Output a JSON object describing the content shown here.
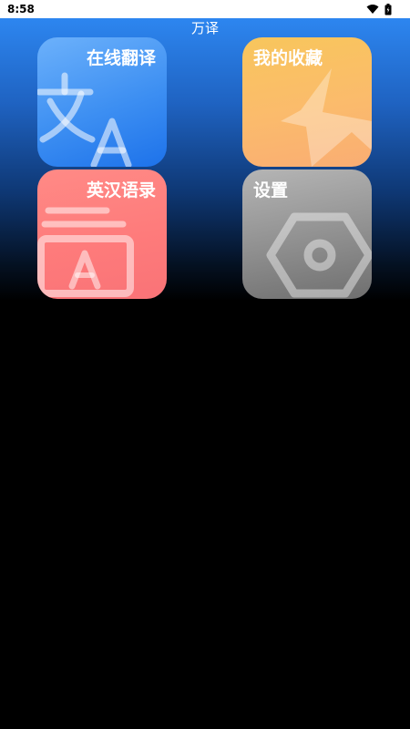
{
  "status_bar": {
    "time": "8:58",
    "icons": [
      "wifi-icon",
      "battery-icon"
    ]
  },
  "app": {
    "title": "万译"
  },
  "tiles": [
    {
      "label": "在线翻译",
      "icon": "translate-icon",
      "color": "#3d8ff2"
    },
    {
      "label": "我的收藏",
      "icon": "star-icon",
      "color": "#fbbb6c"
    },
    {
      "label": "英汉语录",
      "icon": "phrasebook-icon",
      "color": "#fe7b7b"
    },
    {
      "label": "设置",
      "icon": "settings-icon",
      "color": "#8f8f8f"
    }
  ],
  "colors": {
    "header_gradient_top": "#2d86f0",
    "background": "#000000"
  }
}
